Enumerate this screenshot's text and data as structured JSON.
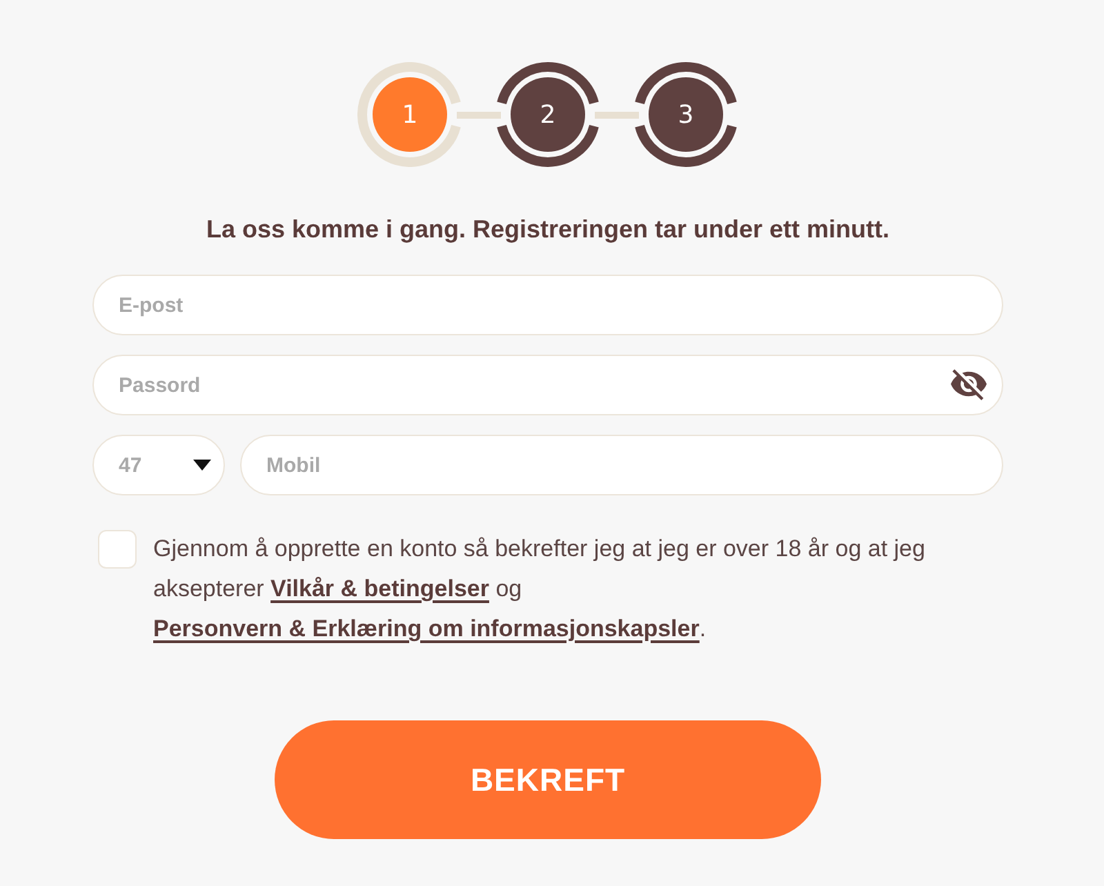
{
  "stepper": {
    "steps": [
      {
        "label": "1",
        "selected": true
      },
      {
        "label": "2",
        "selected": false
      },
      {
        "label": "3",
        "selected": false
      }
    ]
  },
  "heading": "La oss komme i gang. Registreringen tar under ett minutt.",
  "fields": [
    {
      "kind": "email",
      "placeholder": "E-post"
    },
    {
      "kind": "password",
      "placeholder": "Passord"
    }
  ],
  "phone": {
    "country_code": {
      "value": "47"
    },
    "number": {
      "placeholder": "Mobil"
    }
  },
  "consent": {
    "checked": false,
    "parts": [
      {
        "kind": "text",
        "text": "Gjennom å opprette en konto så bekrefter jeg at jeg er over 18 år og at jeg aksepterer "
      },
      {
        "kind": "link",
        "text": "Vilkår & betingelser"
      },
      {
        "kind": "text",
        "text": " og "
      },
      {
        "kind": "link",
        "text": "Personvern & Erklæring om informasjonskapsler"
      },
      {
        "kind": "text",
        "text": "."
      }
    ]
  },
  "submit": {
    "label": "BEKREFT"
  }
}
